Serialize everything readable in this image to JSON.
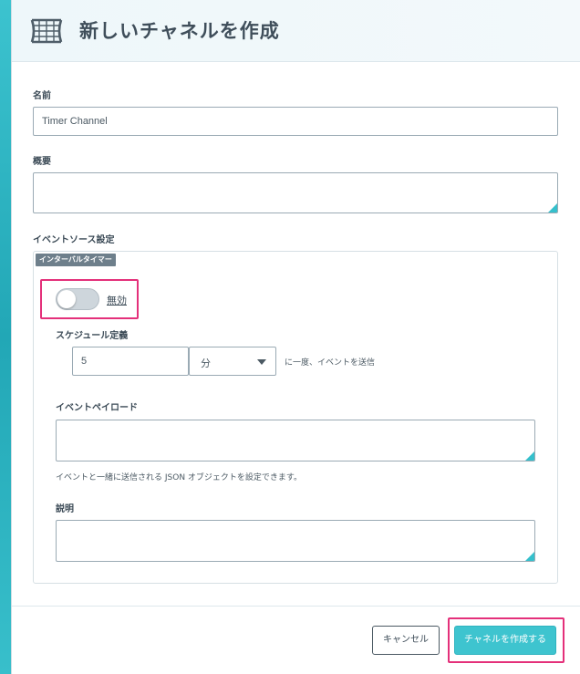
{
  "modal": {
    "title": "新しいチャネルを作成",
    "icon": "channel-icon"
  },
  "form": {
    "name": {
      "label": "名前",
      "value": "Timer Channel"
    },
    "description": {
      "label": "概要",
      "value": ""
    },
    "event_source": {
      "label": "イベントソース設定",
      "tag": "インターバルタイマー",
      "toggle": {
        "state": "off",
        "label": "無効"
      },
      "schedule": {
        "label": "スケジュール定義",
        "interval_value": "5",
        "unit_selected": "分",
        "suffix": "に一度、イベントを送信"
      },
      "payload": {
        "label": "イベントペイロード",
        "value": "",
        "hint": "イベントと一緒に送信される JSON オブジェクトを設定できます。"
      },
      "explanation": {
        "label": "説明",
        "value": ""
      }
    }
  },
  "footer": {
    "cancel_label": "キャンセル",
    "create_label": "チャネルを作成する"
  },
  "colors": {
    "accent": "#3ec4cf",
    "highlight": "#e4307a",
    "background": "#2fb7c4",
    "tag": "#6e7f8b"
  }
}
